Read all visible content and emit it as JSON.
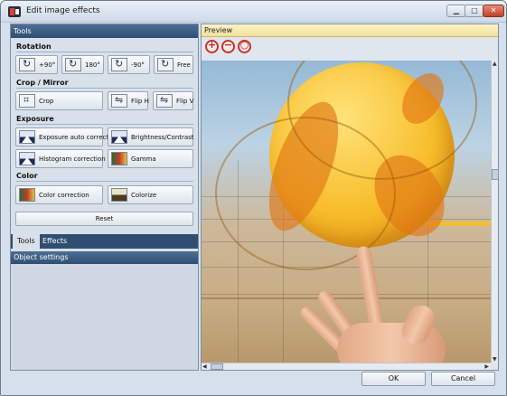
{
  "window": {
    "title": "Edit image effects"
  },
  "tools_panel": {
    "header": "Tools",
    "sections": {
      "rotation": {
        "title": "Rotation",
        "buttons": [
          "+90°",
          "180°",
          "-90°",
          "Free"
        ]
      },
      "crop_mirror": {
        "title": "Crop / Mirror",
        "buttons": [
          "Crop",
          "Flip H",
          "Flip V"
        ]
      },
      "exposure": {
        "title": "Exposure",
        "buttons": [
          "Exposure auto correction",
          "Brightness/Contrast",
          "Histogram correction",
          "Gamma"
        ]
      },
      "color": {
        "title": "Color",
        "buttons": [
          "Color correction",
          "Colorize"
        ]
      }
    },
    "reset_label": "Reset",
    "tabs": [
      "Tools",
      "Effects"
    ],
    "object_settings_header": "Object settings"
  },
  "preview_panel": {
    "header": "Preview",
    "zoom_buttons": [
      "zoom-in",
      "zoom-out",
      "zoom-fit"
    ]
  },
  "footer": {
    "ok_label": "OK",
    "cancel_label": "Cancel"
  }
}
